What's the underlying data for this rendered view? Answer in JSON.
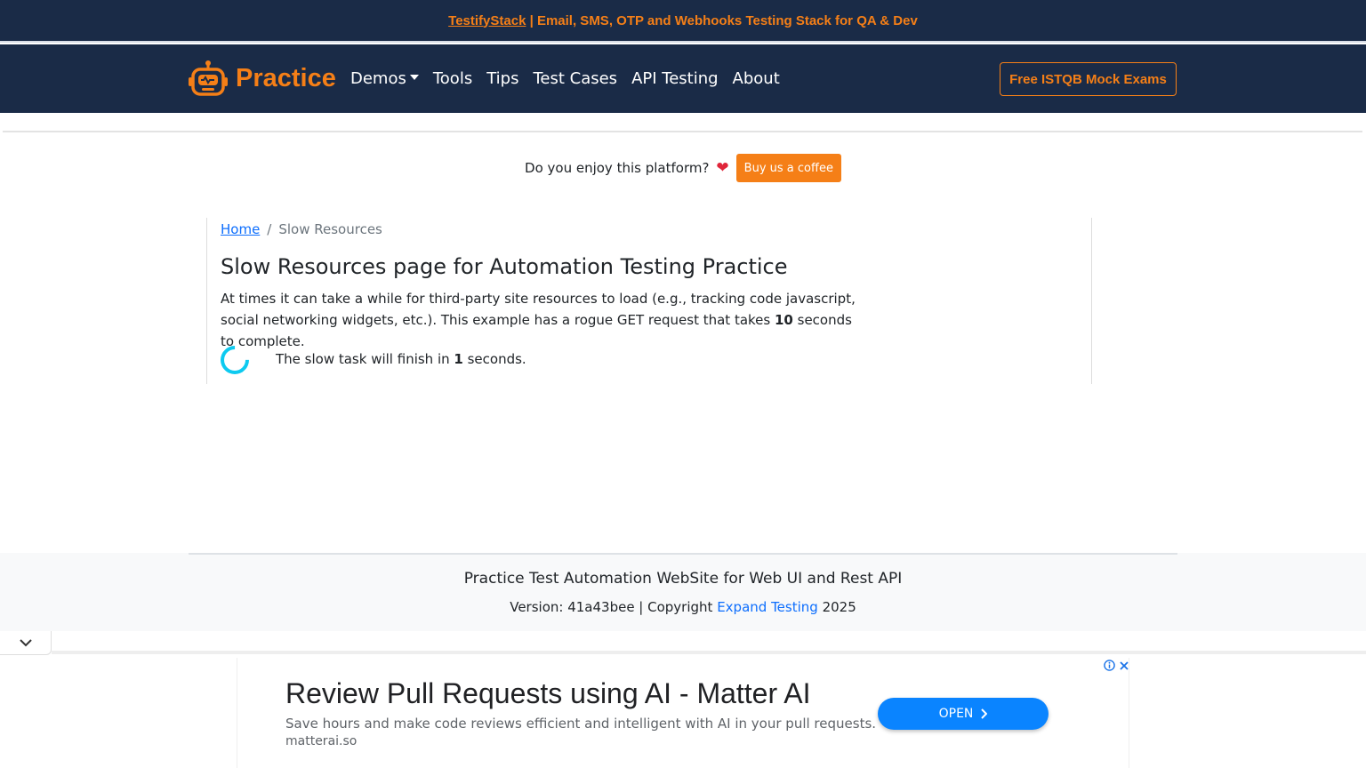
{
  "top_banner": {
    "link_text": "TestifyStack",
    "rest_text": " | Email, SMS, OTP and Webhooks Testing Stack for QA & Dev"
  },
  "navbar": {
    "brand": "Practice",
    "links": [
      "Demos",
      "Tools",
      "Tips",
      "Test Cases",
      "API Testing",
      "About"
    ],
    "cta": "Free ISTQB Mock Exams"
  },
  "support": {
    "question": "Do you enjoy this platform?",
    "button": "Buy us a coffee"
  },
  "breadcrumb": {
    "home": "Home",
    "separator": "/",
    "current": "Slow Resources"
  },
  "page": {
    "title": "Slow Resources page for Automation Testing Practice",
    "desc_part1": "At times it can take a while for third-party site resources to load (e.g., tracking code javascript, social networking widgets, etc.). This example has a rogue GET request that takes ",
    "desc_bold": "10",
    "desc_part2": " seconds to complete.",
    "status_prefix": "The slow task will finish in ",
    "status_count": "1",
    "status_suffix": " seconds."
  },
  "footer": {
    "title": "Practice Test Automation WebSite for Web UI and Rest API",
    "version_prefix": "Version: 41a43bee | Copyright ",
    "link": "Expand Testing",
    "year": " 2025"
  },
  "ad": {
    "headline": "Review Pull Requests using AI - Matter AI",
    "description": "Save hours and make code reviews efficient and intelligent with AI in your pull requests.",
    "url": "matterai.so",
    "button": "OPEN"
  },
  "colors": {
    "navy": "#1a2b47",
    "orange": "#f57f17",
    "link_blue": "#0d6efd",
    "spinner": "#0dcaf0",
    "ad_button": "#0a84ff"
  }
}
